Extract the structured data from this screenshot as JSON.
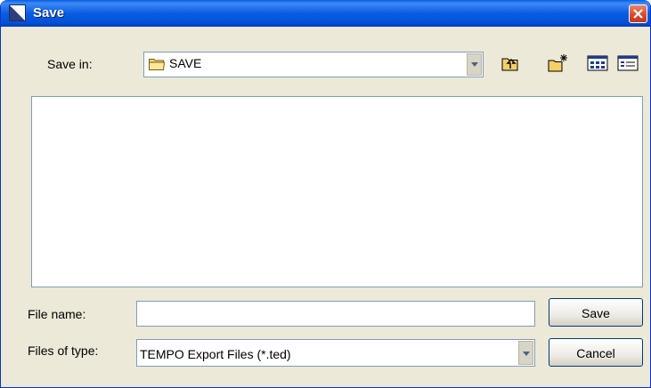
{
  "window": {
    "title": "Save"
  },
  "save_in": {
    "label": "Save in:",
    "value": "SAVE"
  },
  "toolbar": {
    "up_icon": "up-one-level-icon",
    "new_folder_icon": "new-folder-icon",
    "view_icon": "view-menu-icon"
  },
  "file_name": {
    "label": "File name:",
    "value": ""
  },
  "files_of_type": {
    "label": "Files of type:",
    "value": "TEMPO Export Files (*.ted)"
  },
  "buttons": {
    "save": "Save",
    "cancel": "Cancel"
  },
  "colors": {
    "titlebar": "#0a5ce3",
    "dialog_bg": "#ece9d8",
    "close": "#d9472a",
    "input_border": "#7f9db9"
  }
}
